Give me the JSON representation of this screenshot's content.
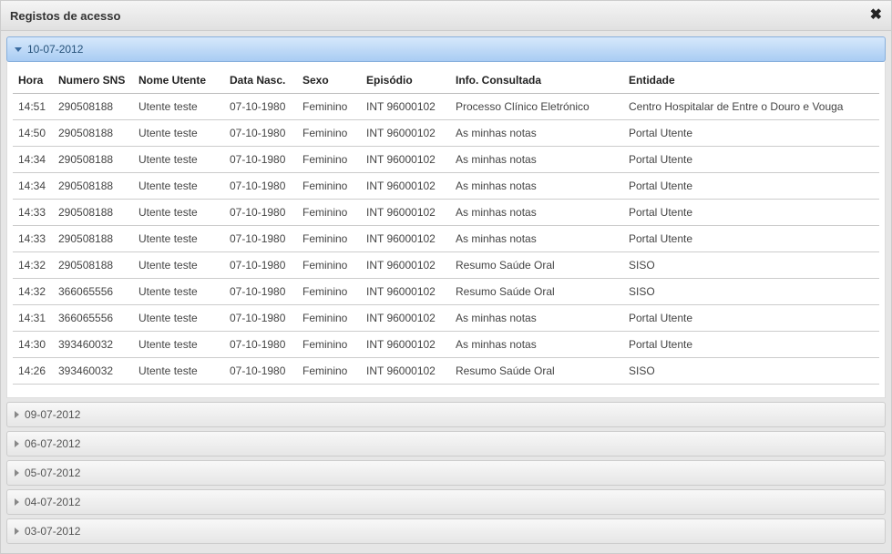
{
  "window": {
    "title": "Registos de acesso",
    "close_label": "✖"
  },
  "accordion": {
    "expanded_date": "10-07-2012",
    "collapsed_dates": [
      "09-07-2012",
      "06-07-2012",
      "05-07-2012",
      "04-07-2012",
      "03-07-2012"
    ]
  },
  "table": {
    "headers": {
      "hora": "Hora",
      "numero_sns": "Numero SNS",
      "nome_utente": "Nome Utente",
      "data_nasc": "Data Nasc.",
      "sexo": "Sexo",
      "episodio": "Episódio",
      "info_consultada": "Info. Consultada",
      "entidade": "Entidade"
    },
    "rows": [
      {
        "hora": "14:51",
        "numero_sns": "290508188",
        "nome_utente": "Utente teste",
        "data_nasc": "07-10-1980",
        "sexo": "Feminino",
        "episodio": "INT 96000102",
        "info_consultada": "Processo Clínico Eletrónico",
        "entidade": "Centro Hospitalar de Entre o Douro e Vouga"
      },
      {
        "hora": "14:50",
        "numero_sns": "290508188",
        "nome_utente": "Utente teste",
        "data_nasc": "07-10-1980",
        "sexo": "Feminino",
        "episodio": "INT 96000102",
        "info_consultada": "As minhas notas",
        "entidade": "Portal Utente"
      },
      {
        "hora": "14:34",
        "numero_sns": "290508188",
        "nome_utente": "Utente teste",
        "data_nasc": "07-10-1980",
        "sexo": "Feminino",
        "episodio": "INT 96000102",
        "info_consultada": "As minhas notas",
        "entidade": "Portal Utente"
      },
      {
        "hora": "14:34",
        "numero_sns": "290508188",
        "nome_utente": "Utente teste",
        "data_nasc": "07-10-1980",
        "sexo": "Feminino",
        "episodio": "INT 96000102",
        "info_consultada": "As minhas notas",
        "entidade": "Portal Utente"
      },
      {
        "hora": "14:33",
        "numero_sns": "290508188",
        "nome_utente": "Utente teste",
        "data_nasc": "07-10-1980",
        "sexo": "Feminino",
        "episodio": "INT 96000102",
        "info_consultada": "As minhas notas",
        "entidade": "Portal Utente"
      },
      {
        "hora": "14:33",
        "numero_sns": "290508188",
        "nome_utente": "Utente teste",
        "data_nasc": "07-10-1980",
        "sexo": "Feminino",
        "episodio": "INT 96000102",
        "info_consultada": "As minhas notas",
        "entidade": "Portal Utente"
      },
      {
        "hora": "14:32",
        "numero_sns": "290508188",
        "nome_utente": "Utente teste",
        "data_nasc": "07-10-1980",
        "sexo": "Feminino",
        "episodio": "INT 96000102",
        "info_consultada": "Resumo Saúde Oral",
        "entidade": "SISO"
      },
      {
        "hora": "14:32",
        "numero_sns": "366065556",
        "nome_utente": "Utente teste",
        "data_nasc": "07-10-1980",
        "sexo": "Feminino",
        "episodio": "INT 96000102",
        "info_consultada": "Resumo Saúde Oral",
        "entidade": "SISO"
      },
      {
        "hora": "14:31",
        "numero_sns": "366065556",
        "nome_utente": "Utente teste",
        "data_nasc": "07-10-1980",
        "sexo": "Feminino",
        "episodio": "INT 96000102",
        "info_consultada": "As minhas notas",
        "entidade": "Portal Utente"
      },
      {
        "hora": "14:30",
        "numero_sns": "393460032",
        "nome_utente": "Utente teste",
        "data_nasc": "07-10-1980",
        "sexo": "Feminino",
        "episodio": "INT 96000102",
        "info_consultada": "As minhas notas",
        "entidade": "Portal Utente"
      },
      {
        "hora": "14:26",
        "numero_sns": "393460032",
        "nome_utente": "Utente teste",
        "data_nasc": "07-10-1980",
        "sexo": "Feminino",
        "episodio": "INT 96000102",
        "info_consultada": "Resumo Saúde Oral",
        "entidade": "SISO"
      }
    ]
  }
}
